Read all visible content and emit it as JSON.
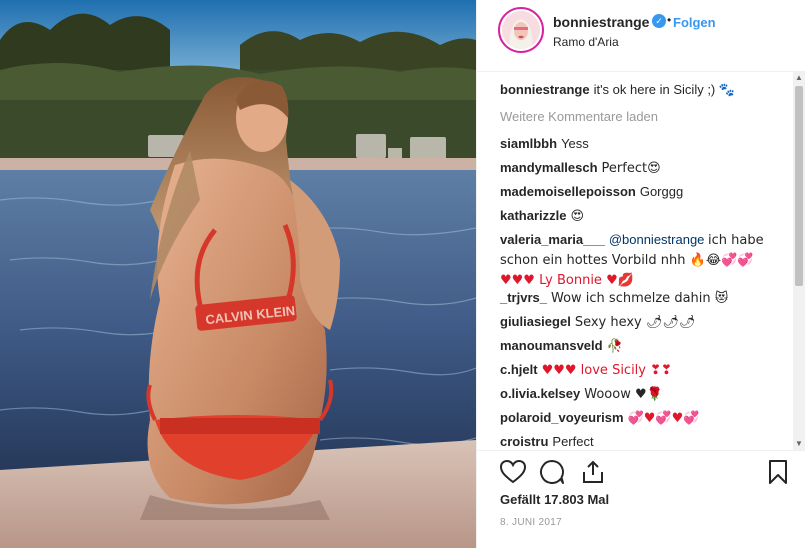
{
  "header": {
    "username": "bonniestrange",
    "verified_icon": "verified-badge-icon",
    "separator": "•",
    "follow_label": "Folgen",
    "location": "Ramo d'Aria"
  },
  "caption": {
    "user": "bonniestrange",
    "text": "it's ok here in Sicily ;)",
    "emoji": "🐾"
  },
  "load_more_label": "Weitere Kommentare laden",
  "comments": [
    {
      "user": "siamlbbh",
      "text": "Yess"
    },
    {
      "user": "mandymallesch",
      "text": "Perfect😍"
    },
    {
      "user": "mademoisellepoisson",
      "text": "Gorggg"
    },
    {
      "user": "katharizzle",
      "text": "😍"
    },
    {
      "user": "valeria_maria___",
      "mention": "@bonniestrange",
      "text": "ich habe schon ein hottes Vorbild nhh 🔥😂💞💞",
      "text2": "♥♥♥ Ly Bonnie ♥💋"
    },
    {
      "user": "_trjvrs_",
      "text": "Wow ich schmelze dahin 😻"
    },
    {
      "user": "giuliasiegel",
      "text": "Sexy hexy 🌶🌶🌶"
    },
    {
      "user": "manoumansveld",
      "text": "🥀"
    },
    {
      "user": "c.hjelt",
      "text": "♥♥♥ love Sicily ❣❣"
    },
    {
      "user": "o.livia.kelsey",
      "text": "Wooow ♥🌹"
    },
    {
      "user": "polaroid_voyeurism",
      "text": "💞♥💞♥💞"
    },
    {
      "user": "croistru",
      "text": "Perfect"
    }
  ],
  "actions": {
    "like_icon": "heart-outline-icon",
    "comment_icon": "comment-icon",
    "share_icon": "share-icon",
    "save_icon": "bookmark-icon"
  },
  "likes_text": "Gefällt 17.803 Mal",
  "date_text": "8. JUNI 2017",
  "photo_text": "CALVIN KLEIN",
  "colors": {
    "link": "#3897f0",
    "text": "#262626",
    "muted": "#999999",
    "border": "#efefef"
  }
}
